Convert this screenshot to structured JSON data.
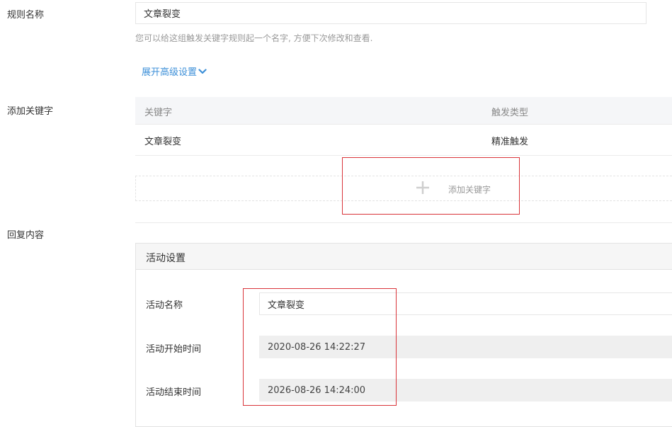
{
  "rule": {
    "name_label": "规则名称",
    "name_value": "文章裂变",
    "name_hint": "您可以给这组触发关键字规则起一个名字, 方便下次修改和查看.",
    "advanced_link": "展开高级设置"
  },
  "keywords": {
    "section_label": "添加关键字",
    "columns": [
      "关键字",
      "触发类型"
    ],
    "rows": [
      {
        "keyword": "文章裂变",
        "trigger_type": "精准触发"
      }
    ],
    "add_label": "添加关键字"
  },
  "reply": {
    "section_label": "回复内容",
    "panel_title": "活动设置",
    "activity_name_label": "活动名称",
    "activity_name_value": "文章裂变",
    "start_time_label": "活动开始时间",
    "start_time_value": "2020-08-26 14:22:27",
    "end_time_label": "活动结束时间",
    "end_time_value": "2026-08-26 14:24:00"
  },
  "colors": {
    "link": "#3c8fd8",
    "highlight_box": "#d9343a",
    "table_header_bg": "#f5f6f8",
    "readonly_field_bg": "#efefef"
  }
}
